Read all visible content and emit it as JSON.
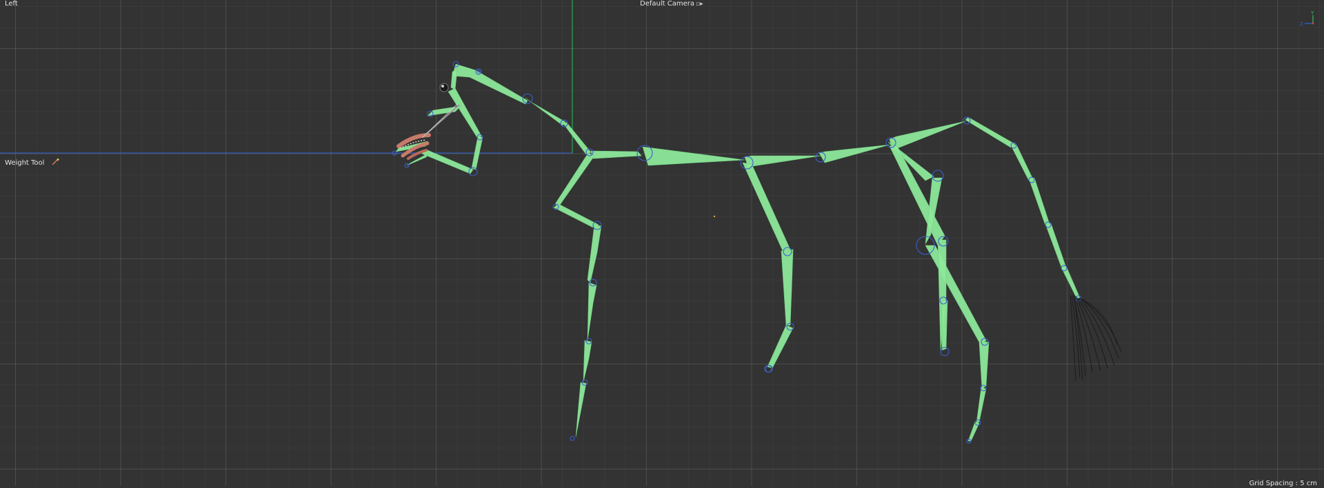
{
  "viewport": {
    "view_name": "Left",
    "camera": "Default Camera",
    "camera_icon": "camera-toggle-icon",
    "active_tool": "Weight Tool",
    "tool_icon": "weight-brush-icon",
    "grid_spacing": "Grid Spacing : 5 cm"
  },
  "axis_gizmo": {
    "y_label": "Y",
    "z_label": "Z"
  },
  "colors": {
    "background": "#333333",
    "bone": "#8de89a",
    "joint": "#3a5fcf",
    "horizontal_axis": "#2f63d8",
    "vertical_axis": "#2fbf62",
    "hud_text": "#e6e6e6"
  },
  "scene": {
    "object": "horse-skeleton-rig",
    "bone_count": 32
  }
}
